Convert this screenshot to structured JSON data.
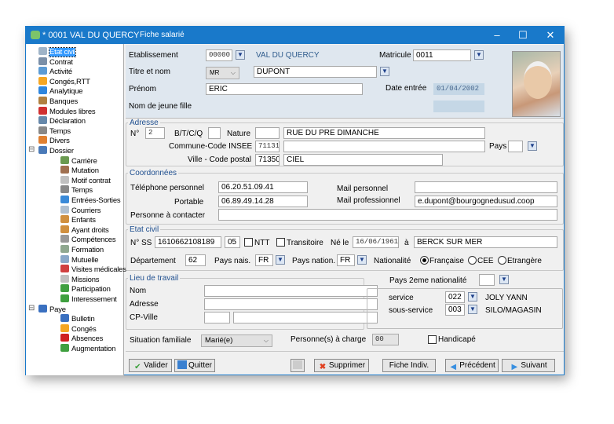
{
  "window": {
    "title": "* 0001  VAL DU QUERCY",
    "subtitle": "Fiche salarié",
    "minimize": "–",
    "maximize": "☐",
    "close": "✕"
  },
  "sidebar": {
    "items": [
      {
        "label": "Etat civil",
        "icon": "id-card-icon",
        "color": "#9fb4c8"
      },
      {
        "label": "Contrat",
        "icon": "contract-icon",
        "color": "#7a8fa8"
      },
      {
        "label": "Activité",
        "icon": "activity-chart-icon",
        "color": "#5b9bd5"
      },
      {
        "label": "Congés,RTT",
        "icon": "sun-icon",
        "color": "#f5a623"
      },
      {
        "label": "Analytique",
        "icon": "pie-chart-icon",
        "color": "#2e86de"
      },
      {
        "label": "Banques",
        "icon": "bank-icon",
        "color": "#b08040"
      },
      {
        "label": "Modules libres",
        "icon": "blocks-icon",
        "color": "#d03030"
      },
      {
        "label": "Déclaration",
        "icon": "declaration-icon",
        "color": "#6688aa"
      },
      {
        "label": "Temps",
        "icon": "clock-icon",
        "color": "#888888"
      },
      {
        "label": "Divers",
        "icon": "misc-icon",
        "color": "#e08030"
      },
      {
        "label": "Dossier",
        "icon": "folder-icon",
        "color": "#4a7ab8"
      },
      {
        "label": "Carrière",
        "icon": "career-icon",
        "color": "#6a9a50"
      },
      {
        "label": "Mutation",
        "icon": "mutation-icon",
        "color": "#a07050"
      },
      {
        "label": "Motif contrat",
        "icon": "reason-icon",
        "color": "#c0c0c0"
      },
      {
        "label": "Temps",
        "icon": "clock-icon",
        "color": "#888888"
      },
      {
        "label": "Entrées-Sorties",
        "icon": "refresh-icon",
        "color": "#3a8ad8"
      },
      {
        "label": "Courriers",
        "icon": "mail-icon",
        "color": "#b0c0d0"
      },
      {
        "label": "Enfants",
        "icon": "people-icon",
        "color": "#d09040"
      },
      {
        "label": "Ayant droits",
        "icon": "people-icon",
        "color": "#d09040"
      },
      {
        "label": "Compétences",
        "icon": "gears-icon",
        "color": "#999999"
      },
      {
        "label": "Formation",
        "icon": "calendar-icon",
        "color": "#90a890"
      },
      {
        "label": "Mutuelle",
        "icon": "document-icon",
        "color": "#8aa8c8"
      },
      {
        "label": "Visites médicales",
        "icon": "pill-icon",
        "color": "#d04040"
      },
      {
        "label": "Missions",
        "icon": "mission-icon",
        "color": "#c0c0c0"
      },
      {
        "label": "Participation",
        "icon": "bar-chart-icon",
        "color": "#40a040"
      },
      {
        "label": "Interessement",
        "icon": "bar-chart-icon",
        "color": "#40a040"
      },
      {
        "label": "Paye",
        "icon": "pay-icon",
        "color": "#3a70c0"
      },
      {
        "label": "Bulletin",
        "icon": "payslip-icon",
        "color": "#3a70c0"
      },
      {
        "label": "Congés",
        "icon": "sun-icon",
        "color": "#f5a623"
      },
      {
        "label": "Absences",
        "icon": "absence-icon",
        "color": "#d02020"
      },
      {
        "label": "Augmentation",
        "icon": "increase-icon",
        "color": "#40a040"
      }
    ]
  },
  "header": {
    "etab_label": "Etablissement",
    "etab_code": "00000",
    "etab_name": "VAL DU QUERCY",
    "matricule_label": "Matricule",
    "matricule": "0011",
    "titre_label": "Titre et nom",
    "titre": "MR",
    "nom": "DUPONT",
    "prenom_label": "Prénom",
    "prenom": "ERIC",
    "date_entree_label": "Date entrée",
    "date_entree": "01/04/2002",
    "jeune_fille_label": "Nom de jeune fille",
    "jeune_fille": ""
  },
  "adresse": {
    "title": "Adresse",
    "num_label": "N°",
    "num": "2",
    "btcq_label": "B/T/C/Q",
    "btcq": "",
    "nature_label": "Nature",
    "nature": "",
    "rue": "RUE DU PRE DIMANCHE",
    "insee_label": "Commune-Code INSEE",
    "insee": "71131",
    "commune": "",
    "pays_label": "Pays",
    "pays": "",
    "ville_label": "Ville - Code postal",
    "cp": "71350",
    "ville": "CIEL"
  },
  "coord": {
    "title": "Coordonnées",
    "tel_label": "Téléphone personnel",
    "tel": "06.20.51.09.41",
    "portable_label": "Portable",
    "portable": "06.89.49.14.28",
    "mail_perso_label": "Mail personnel",
    "mail_perso": "",
    "mail_pro_label": "Mail professionnel",
    "mail_pro": "e.dupont@bourgognedusud.coop",
    "contact_label": "Personne à contacter",
    "contact": ""
  },
  "etat": {
    "title": "Etat civil",
    "ss_label": "N° SS",
    "ss": "1610662108189",
    "ss_key": "05",
    "ntt_label": "NTT",
    "trans_label": "Transitoire",
    "ne_label": "Né le",
    "ne": "16/06/1961",
    "a_label": "à",
    "lieu": "BERCK SUR MER",
    "dep_label": "Département",
    "dep": "62",
    "pays_nais_label": "Pays nais.",
    "pays_nais": "FR",
    "pays_nation_label": "Pays nation.",
    "pays_nation": "FR",
    "nat_label": "Nationalité",
    "nat_options": [
      "Française",
      "CEE",
      "Etrangère"
    ]
  },
  "travail": {
    "title": "Lieu de travail",
    "nom_label": "Nom",
    "adresse_label": "Adresse",
    "cp_label": "CP-Ville"
  },
  "service": {
    "pays2_label": "Pays 2eme nationalité",
    "service_label": "service",
    "service_code": "022",
    "service_name": "JOLY YANN",
    "sous_label": "sous-service",
    "sous_code": "003",
    "sous_name": "SILO/MAGASIN"
  },
  "famille": {
    "sit_label": "Situation familiale",
    "sit": "Marié(e)",
    "charge_label": "Personne(s) à charge",
    "charge": "00",
    "handicap_label": "Handicapé"
  },
  "buttons": {
    "valider": "Valider",
    "quitter": "Quitter",
    "supprimer": "Supprimer",
    "fiche": "Fiche Indiv.",
    "precedent": "Précédent",
    "suivant": "Suivant"
  }
}
